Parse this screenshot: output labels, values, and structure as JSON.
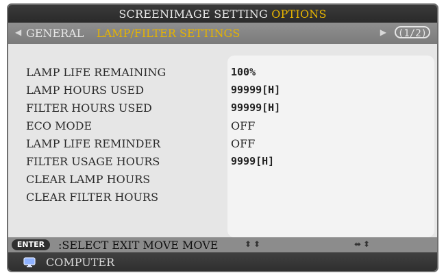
{
  "header": {
    "title_prefix": "SCREENIMAGE SETTING ",
    "title_highlight": "OPTIONS"
  },
  "tabs": {
    "general": "GENERAL",
    "lamp_filter": "LAMP/FILTER SETTINGS",
    "page": "(1/2)"
  },
  "settings": [
    {
      "label": "LAMP LIFE REMAINING",
      "value": "100%"
    },
    {
      "label": "LAMP HOURS USED",
      "value": "99999[H]"
    },
    {
      "label": "FILTER HOURS USED",
      "value": "99999[H]"
    },
    {
      "label": "ECO MODE",
      "value": "OFF"
    },
    {
      "label": "LAMP LIFE REMINDER",
      "value": "OFF"
    },
    {
      "label": "FILTER USAGE HOURS",
      "value": "9999[H]"
    },
    {
      "label": "CLEAR LAMP HOURS",
      "value": ""
    },
    {
      "label": "CLEAR FILTER HOURS",
      "value": ""
    }
  ],
  "footer": {
    "enter": "ENTER",
    "help": ":SELECT EXIT MOVE MOVE"
  },
  "source": {
    "label": "COMPUTER"
  },
  "colors": {
    "highlight": "#e6b400",
    "topbar": "#2f2f2f",
    "panel": "#f3f3f3"
  }
}
